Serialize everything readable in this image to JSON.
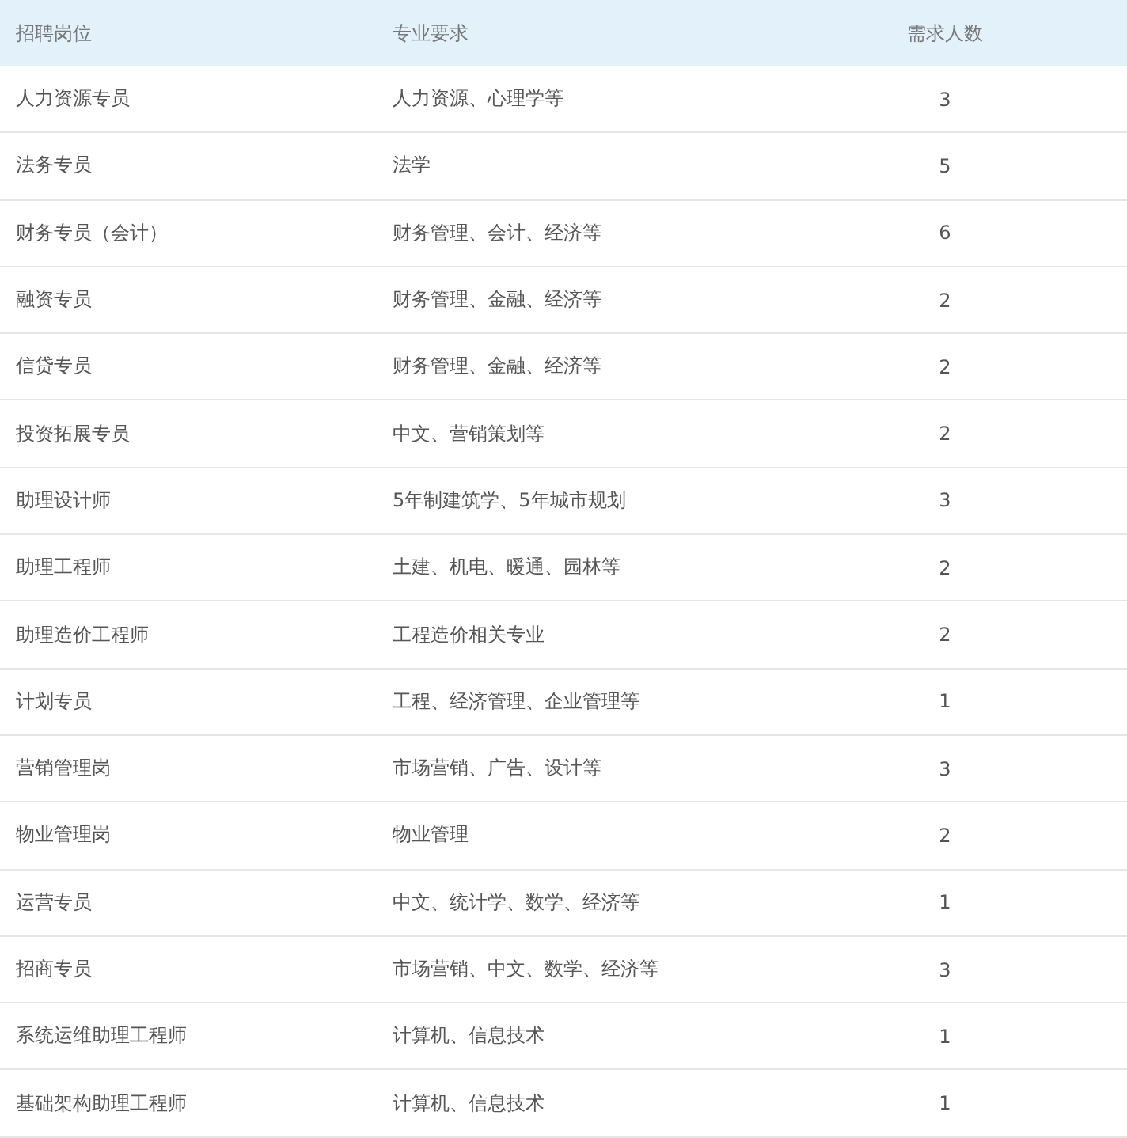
{
  "table": {
    "columns": [
      "招聘岗位",
      "专业要求",
      "需求人数"
    ],
    "rows": [
      [
        "人力资源专员",
        "人力资源、心理学等",
        "3"
      ],
      [
        "法务专员",
        "法学",
        "5"
      ],
      [
        "财务专员（会计）",
        "财务管理、会计、经济等",
        "6"
      ],
      [
        "融资专员",
        "财务管理、金融、经济等",
        "2"
      ],
      [
        "信贷专员",
        "财务管理、金融、经济等",
        "2"
      ],
      [
        "投资拓展专员",
        "中文、营销策划等",
        "2"
      ],
      [
        "助理设计师",
        "5年制建筑学、5年城市规划",
        "3"
      ],
      [
        "助理工程师",
        "土建、机电、暖通、园林等",
        "2"
      ],
      [
        "助理造价工程师",
        "工程造价相关专业",
        "2"
      ],
      [
        "计划专员",
        "工程、经济管理、企业管理等",
        "1"
      ],
      [
        "营销管理岗",
        "市场营销、广告、设计等",
        "3"
      ],
      [
        "物业管理岗",
        "物业管理",
        "2"
      ],
      [
        "运营专员",
        "中文、统计学、数学、经济等",
        "1"
      ],
      [
        "招商专员",
        "市场营销、中文、数学、经济等",
        "3"
      ],
      [
        "系统运维助理工程师",
        "计算机、信息技术",
        "1"
      ],
      [
        "基础架构助理工程师",
        "计算机、信息技术",
        "1"
      ]
    ]
  }
}
